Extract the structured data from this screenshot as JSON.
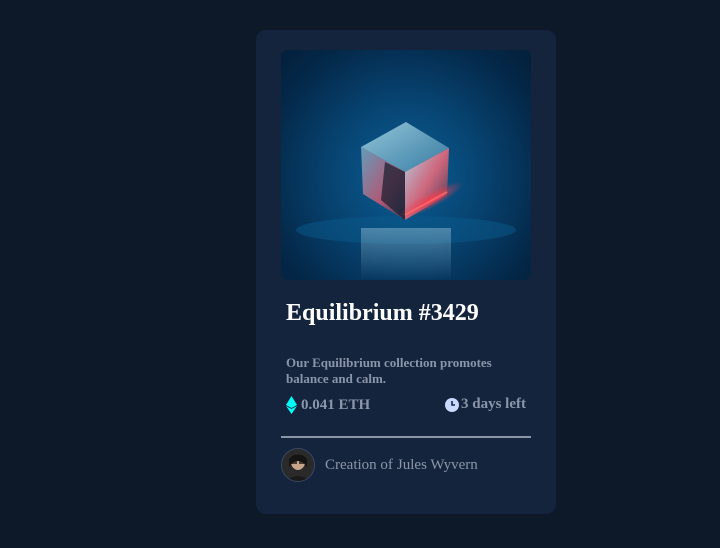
{
  "card": {
    "image_alt": "Equilibrium cube",
    "title": "Equilibrium #3429",
    "description": "Our Equilibrium collection promotes balance and calm.",
    "price": "0.041 ETH",
    "price_icon": "ethereum-icon",
    "time_left": "3 days left",
    "time_icon": "clock-icon",
    "creator_prefix": "Creation of",
    "creator_name": "Jules Wyvern"
  },
  "colors": {
    "page_bg": "#0d1829",
    "card_bg": "#15243d",
    "accent_cyan": "#00fff8",
    "muted_text": "#8a96a8",
    "white": "#ffffff"
  }
}
